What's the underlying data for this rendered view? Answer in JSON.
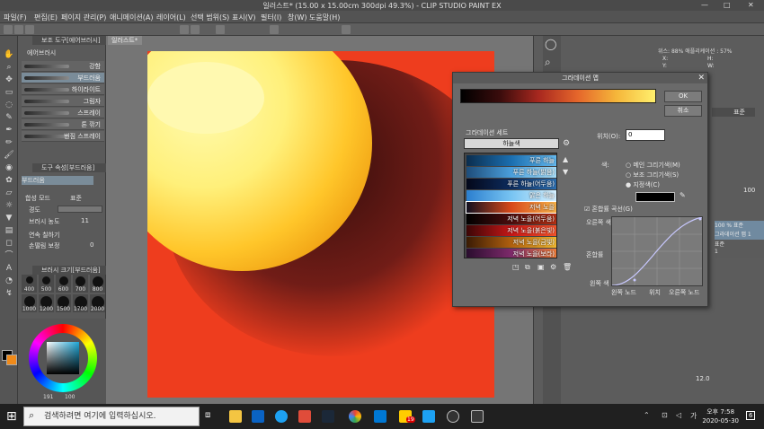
{
  "window": {
    "title": "일러스트* (15.00 x 15.00cm 300dpi 49.3%) - CLIP STUDIO PAINT EX",
    "minimize": "—",
    "maximize": "□",
    "close": "✕"
  },
  "menu": {
    "items": [
      "파일(F)",
      "편집(E)",
      "페이지 관리(P)",
      "애니메이션(A)",
      "레이어(L)",
      "선택 범위(S)",
      "표시(V)",
      "필터(I)",
      "창(W)",
      "도움말(H)"
    ]
  },
  "document_tab": {
    "label": "일러스트*"
  },
  "sub_tool_panel": {
    "tab_label": "보조 도구[에어브러시]",
    "group_label": "에어브러시",
    "brushes": [
      "강함",
      "부드러움",
      "하이라이트",
      "그림자",
      "스프레이",
      "톤 깎기",
      "번짐 스프레이"
    ],
    "selected_index": 1
  },
  "tool_property": {
    "tab_label": "도구 속성[부드러움]",
    "brush_name": "부드러움",
    "blend_mode_label": "합성 모드",
    "blend_mode_value": "표준",
    "hardness_label": "경도",
    "density_label": "브러시 농도",
    "density_value": "11",
    "continuous_label": "연속 칠하기",
    "smoothing_label": "손떨림 보정",
    "smoothing_value": "0"
  },
  "brush_size_panel": {
    "tab_label": "브러시 크기[부드러움]",
    "sizes": [
      "400",
      "500",
      "600",
      "700",
      "800",
      "1000",
      "1200",
      "1500",
      "1700",
      "2000"
    ]
  },
  "color_panel": {
    "hue_value": "191",
    "saturation_value": "100"
  },
  "right_panel": {
    "zoom_readout": "위스: 88% 애플리케이션 : 57%",
    "x_label": "X:",
    "y_label": "Y:",
    "h_label": "H:",
    "w_label": "W:",
    "normal_mode": "표준",
    "opacity_value": "100",
    "layer_opacity": "100 % 표준",
    "layer_name": "그라데이션 맵 1",
    "layer_blend": "표준",
    "layer_other": "1",
    "bottom_value": "12.0"
  },
  "gradient_map_dialog": {
    "title": "그라데이션 맵",
    "ok_label": "OK",
    "cancel_label": "취소",
    "position_label": "위치(O):",
    "position_value": "0",
    "set_label": "그라데이션 세트",
    "set_value": "하늘색",
    "color_label": "색:",
    "main_color_option": "메인 그리기색(M)",
    "sub_color_option": "보조 그리기색(S)",
    "specified_color_option": "지정색(C)",
    "blend_curve_label": "혼합률 곡선(G)",
    "right_color_label": "오른쪽 색",
    "blend_rate_label": "혼합률",
    "left_color_label": "왼쪽 색",
    "x_axis_left": "왼쪽 노드",
    "x_axis_mid": "위치",
    "x_axis_right": "오른쪽 노드",
    "gradient_items": [
      {
        "label": "푸른 하늘",
        "colors": [
          "#0b2d4e",
          "#1b6fb0",
          "#64b8ee"
        ]
      },
      {
        "label": "푸른 하늘(밝음)",
        "colors": [
          "#1e4d7a",
          "#4b9fdc",
          "#a6dcf7"
        ]
      },
      {
        "label": "푸른 하늘(어두움)",
        "colors": [
          "#04081a",
          "#0d2c5e",
          "#2d6fb0"
        ]
      },
      {
        "label": "맑은 하늘",
        "colors": [
          "#2b7fcf",
          "#78c4f2",
          "#d6f0ff"
        ]
      },
      {
        "label": "저녁 노을",
        "colors": [
          "#121020",
          "#d84a1a",
          "#f7b24a"
        ]
      },
      {
        "label": "저녁 노을(어두움)",
        "colors": [
          "#000000",
          "#4a0d0d",
          "#b33014"
        ]
      },
      {
        "label": "저녁 노을(붉은빛)",
        "colors": [
          "#3c0606",
          "#c51717",
          "#f3532a"
        ]
      },
      {
        "label": "저녁 노을(금빛)",
        "colors": [
          "#3a1b04",
          "#b0600f",
          "#f0b830"
        ]
      },
      {
        "label": "저녁 노을(보라)",
        "colors": [
          "#2a0d2e",
          "#7e2a6b",
          "#f07e3a"
        ]
      }
    ],
    "selected_index": 4,
    "specified_color": "#000000",
    "bar_colors": [
      "#000000",
      "#3a0c0c",
      "#a8281f",
      "#e5662b",
      "#f5b63a",
      "#fff06d"
    ]
  },
  "taskbar": {
    "search_placeholder": "검색하려면 여기에 입력하십시오.",
    "time": "오후 7:58",
    "date": "2020-05-30",
    "notification_count": "6",
    "badge_count": "19"
  }
}
